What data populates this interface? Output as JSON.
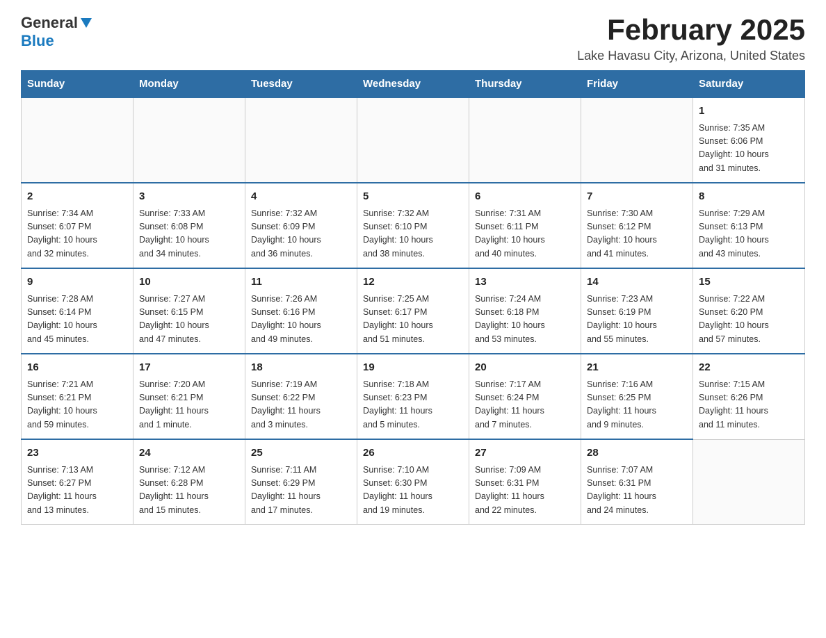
{
  "header": {
    "logo": {
      "text_general": "General",
      "text_blue": "Blue"
    },
    "title": "February 2025",
    "location": "Lake Havasu City, Arizona, United States"
  },
  "calendar": {
    "days_of_week": [
      "Sunday",
      "Monday",
      "Tuesday",
      "Wednesday",
      "Thursday",
      "Friday",
      "Saturday"
    ],
    "weeks": [
      {
        "days": [
          {
            "number": "",
            "info": ""
          },
          {
            "number": "",
            "info": ""
          },
          {
            "number": "",
            "info": ""
          },
          {
            "number": "",
            "info": ""
          },
          {
            "number": "",
            "info": ""
          },
          {
            "number": "",
            "info": ""
          },
          {
            "number": "1",
            "info": "Sunrise: 7:35 AM\nSunset: 6:06 PM\nDaylight: 10 hours\nand 31 minutes."
          }
        ]
      },
      {
        "days": [
          {
            "number": "2",
            "info": "Sunrise: 7:34 AM\nSunset: 6:07 PM\nDaylight: 10 hours\nand 32 minutes."
          },
          {
            "number": "3",
            "info": "Sunrise: 7:33 AM\nSunset: 6:08 PM\nDaylight: 10 hours\nand 34 minutes."
          },
          {
            "number": "4",
            "info": "Sunrise: 7:32 AM\nSunset: 6:09 PM\nDaylight: 10 hours\nand 36 minutes."
          },
          {
            "number": "5",
            "info": "Sunrise: 7:32 AM\nSunset: 6:10 PM\nDaylight: 10 hours\nand 38 minutes."
          },
          {
            "number": "6",
            "info": "Sunrise: 7:31 AM\nSunset: 6:11 PM\nDaylight: 10 hours\nand 40 minutes."
          },
          {
            "number": "7",
            "info": "Sunrise: 7:30 AM\nSunset: 6:12 PM\nDaylight: 10 hours\nand 41 minutes."
          },
          {
            "number": "8",
            "info": "Sunrise: 7:29 AM\nSunset: 6:13 PM\nDaylight: 10 hours\nand 43 minutes."
          }
        ]
      },
      {
        "days": [
          {
            "number": "9",
            "info": "Sunrise: 7:28 AM\nSunset: 6:14 PM\nDaylight: 10 hours\nand 45 minutes."
          },
          {
            "number": "10",
            "info": "Sunrise: 7:27 AM\nSunset: 6:15 PM\nDaylight: 10 hours\nand 47 minutes."
          },
          {
            "number": "11",
            "info": "Sunrise: 7:26 AM\nSunset: 6:16 PM\nDaylight: 10 hours\nand 49 minutes."
          },
          {
            "number": "12",
            "info": "Sunrise: 7:25 AM\nSunset: 6:17 PM\nDaylight: 10 hours\nand 51 minutes."
          },
          {
            "number": "13",
            "info": "Sunrise: 7:24 AM\nSunset: 6:18 PM\nDaylight: 10 hours\nand 53 minutes."
          },
          {
            "number": "14",
            "info": "Sunrise: 7:23 AM\nSunset: 6:19 PM\nDaylight: 10 hours\nand 55 minutes."
          },
          {
            "number": "15",
            "info": "Sunrise: 7:22 AM\nSunset: 6:20 PM\nDaylight: 10 hours\nand 57 minutes."
          }
        ]
      },
      {
        "days": [
          {
            "number": "16",
            "info": "Sunrise: 7:21 AM\nSunset: 6:21 PM\nDaylight: 10 hours\nand 59 minutes."
          },
          {
            "number": "17",
            "info": "Sunrise: 7:20 AM\nSunset: 6:21 PM\nDaylight: 11 hours\nand 1 minute."
          },
          {
            "number": "18",
            "info": "Sunrise: 7:19 AM\nSunset: 6:22 PM\nDaylight: 11 hours\nand 3 minutes."
          },
          {
            "number": "19",
            "info": "Sunrise: 7:18 AM\nSunset: 6:23 PM\nDaylight: 11 hours\nand 5 minutes."
          },
          {
            "number": "20",
            "info": "Sunrise: 7:17 AM\nSunset: 6:24 PM\nDaylight: 11 hours\nand 7 minutes."
          },
          {
            "number": "21",
            "info": "Sunrise: 7:16 AM\nSunset: 6:25 PM\nDaylight: 11 hours\nand 9 minutes."
          },
          {
            "number": "22",
            "info": "Sunrise: 7:15 AM\nSunset: 6:26 PM\nDaylight: 11 hours\nand 11 minutes."
          }
        ]
      },
      {
        "days": [
          {
            "number": "23",
            "info": "Sunrise: 7:13 AM\nSunset: 6:27 PM\nDaylight: 11 hours\nand 13 minutes."
          },
          {
            "number": "24",
            "info": "Sunrise: 7:12 AM\nSunset: 6:28 PM\nDaylight: 11 hours\nand 15 minutes."
          },
          {
            "number": "25",
            "info": "Sunrise: 7:11 AM\nSunset: 6:29 PM\nDaylight: 11 hours\nand 17 minutes."
          },
          {
            "number": "26",
            "info": "Sunrise: 7:10 AM\nSunset: 6:30 PM\nDaylight: 11 hours\nand 19 minutes."
          },
          {
            "number": "27",
            "info": "Sunrise: 7:09 AM\nSunset: 6:31 PM\nDaylight: 11 hours\nand 22 minutes."
          },
          {
            "number": "28",
            "info": "Sunrise: 7:07 AM\nSunset: 6:31 PM\nDaylight: 11 hours\nand 24 minutes."
          },
          {
            "number": "",
            "info": ""
          }
        ]
      }
    ]
  }
}
